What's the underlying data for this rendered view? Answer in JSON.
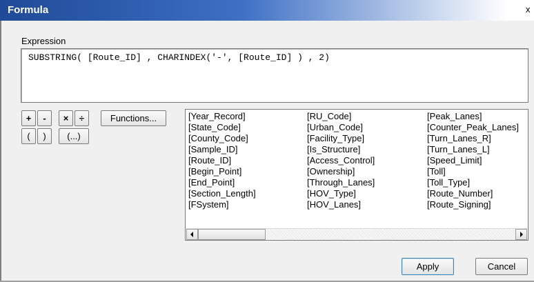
{
  "window": {
    "title": "Formula",
    "close_glyph": "x"
  },
  "expression": {
    "label": "Expression",
    "value": "SUBSTRING( [Route_ID] , CHARINDEX('-', [Route_ID] ) , 2)"
  },
  "operators": {
    "plus": "+",
    "minus": "-",
    "multiply": "×",
    "divide": "÷",
    "open_paren": "(",
    "close_paren": ")",
    "paren_group": "(...)"
  },
  "functions_button": "Functions...",
  "fields": {
    "columns": [
      [
        "[Year_Record]",
        "[State_Code]",
        "[County_Code]",
        "[Sample_ID]",
        "[Route_ID]",
        "[Begin_Point]",
        "[End_Point]",
        "[Section_Length]",
        "[FSystem]"
      ],
      [
        "[RU_Code]",
        "[Urban_Code]",
        "[Facility_Type]",
        "[Is_Structure]",
        "[Access_Control]",
        "[Ownership]",
        "[Through_Lanes]",
        "[HOV_Type]",
        "[HOV_Lanes]"
      ],
      [
        "[Peak_Lanes]",
        "[Counter_Peak_Lanes]",
        "[Turn_Lanes_R]",
        "[Turn_Lanes_L]",
        "[Speed_Limit]",
        "[Toll]",
        "[Toll_Type]",
        "[Route_Number]",
        "[Route_Signing]"
      ]
    ]
  },
  "scrollbar": {
    "left_arrow_icon": "scroll-left-arrow",
    "right_arrow_icon": "scroll-right-arrow"
  },
  "actions": {
    "apply": "Apply",
    "cancel": "Cancel"
  },
  "colors": {
    "titlebar_start": "#1f4a97",
    "titlebar_end": "#ffffff",
    "default_button_border": "#3c7fb1"
  }
}
